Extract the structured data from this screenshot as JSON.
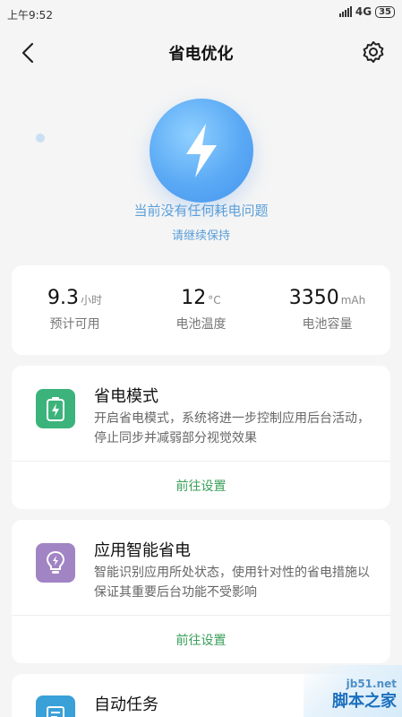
{
  "status_bar": {
    "time": "上午9:52",
    "network": "4G",
    "battery": "35"
  },
  "header": {
    "title": "省电优化"
  },
  "hero": {
    "main": "当前没有任何耗电问题",
    "sub": "请继续保持"
  },
  "stats": [
    {
      "value": "9.3",
      "unit": "小时",
      "label": "预计可用"
    },
    {
      "value": "12",
      "unit": "°C",
      "label": "电池温度"
    },
    {
      "value": "3350",
      "unit": "mAh",
      "label": "电池容量"
    }
  ],
  "features": [
    {
      "title": "省电模式",
      "desc": "开启省电模式，系统将进一步控制应用后台活动，停止同步并减弱部分视觉效果",
      "link": "前往设置",
      "color": "#3cb37a"
    },
    {
      "title": "应用智能省电",
      "desc": "智能识别应用所处状态，使用针对性的省电措施以保证其重要后台功能不受影响",
      "link": "前往设置",
      "color": "#a184c4"
    },
    {
      "title": "自动任务",
      "color": "#3aa0d8"
    }
  ],
  "watermark": {
    "top": "jb51.net",
    "bottom": "脚本之家"
  }
}
